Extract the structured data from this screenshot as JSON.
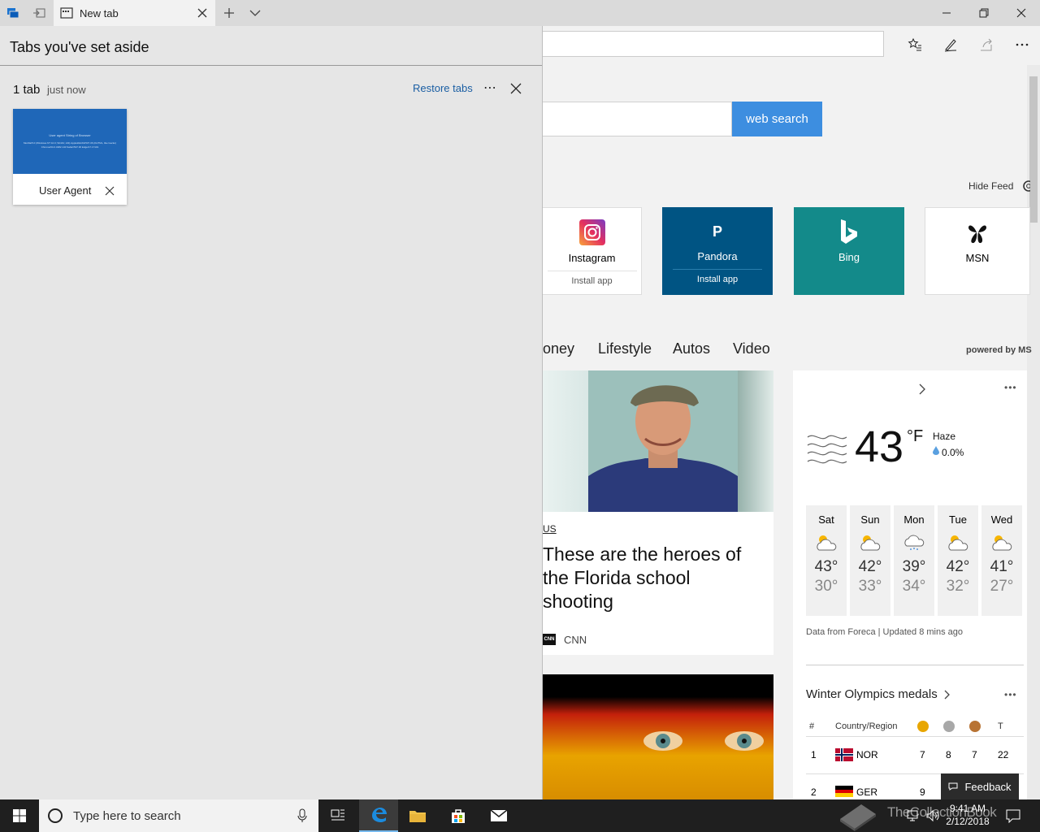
{
  "titlebar": {
    "active_tab_title": "New tab"
  },
  "tabs_aside": {
    "title": "Tabs you've set aside",
    "group_count": "1 tab",
    "group_time": "just now",
    "restore_label": "Restore tabs",
    "more_label": "⋯",
    "thumbnail": {
      "label": "User Agent",
      "preview_heading": "User agent String of Browser",
      "preview_text": "Mozilla/5.0 (Windows NT 10.0; Win64; x64) AppleWebKit/537.36 (KHTML, like Gecko) Chrome/64.0.3282.140 Safari/537.36 Edge/17.17101"
    }
  },
  "newtab": {
    "search_button": "web search",
    "hide_feed": "Hide Feed",
    "tiles": [
      {
        "name": "Instagram",
        "sub": "Install app"
      },
      {
        "name": "Pandora",
        "sub": "Install app",
        "glyph": "P"
      },
      {
        "name": "Bing",
        "sub": ""
      },
      {
        "name": "MSN",
        "sub": ""
      }
    ],
    "nav": [
      "oney",
      "Lifestyle",
      "Autos",
      "Video"
    ],
    "powered_by": "powered by MS",
    "news": {
      "category": "US",
      "headline": "These are the heroes of the Florida school shooting",
      "source_logo": "CNN",
      "source": "CNN"
    },
    "weather": {
      "more": "•••",
      "temp": "43",
      "unit": "°F",
      "condition": "Haze",
      "precip": "0.0%",
      "days": [
        {
          "day": "Sat",
          "hi": "43°",
          "lo": "30°"
        },
        {
          "day": "Sun",
          "hi": "42°",
          "lo": "33°"
        },
        {
          "day": "Mon",
          "hi": "39°",
          "lo": "34°"
        },
        {
          "day": "Tue",
          "hi": "42°",
          "lo": "32°"
        },
        {
          "day": "Wed",
          "hi": "41°",
          "lo": "27°"
        }
      ],
      "source": "Data from Foreca | Updated 8 mins ago"
    },
    "medals": {
      "title": "Winter Olympics medals",
      "more": "•••",
      "header": {
        "rank": "#",
        "country": "Country/Region",
        "total": "T"
      },
      "rows": [
        {
          "rank": "1",
          "country": "NOR",
          "gold": "7",
          "silver": "8",
          "bronze": "7",
          "total": "22"
        },
        {
          "rank": "2",
          "country": "GER",
          "gold": "9",
          "silver": "",
          "bronze": "",
          "total": ""
        }
      ]
    },
    "feedback": "Feedback"
  },
  "taskbar": {
    "search_placeholder": "Type here to search",
    "time": "9:41 AM",
    "date": "2/12/2018",
    "watermark": "TheCollectionBook"
  },
  "colors": {
    "accent": "#0078d7",
    "search_button": "#3d8ee0",
    "pandora": "#005483",
    "bing": "#138a8a"
  }
}
